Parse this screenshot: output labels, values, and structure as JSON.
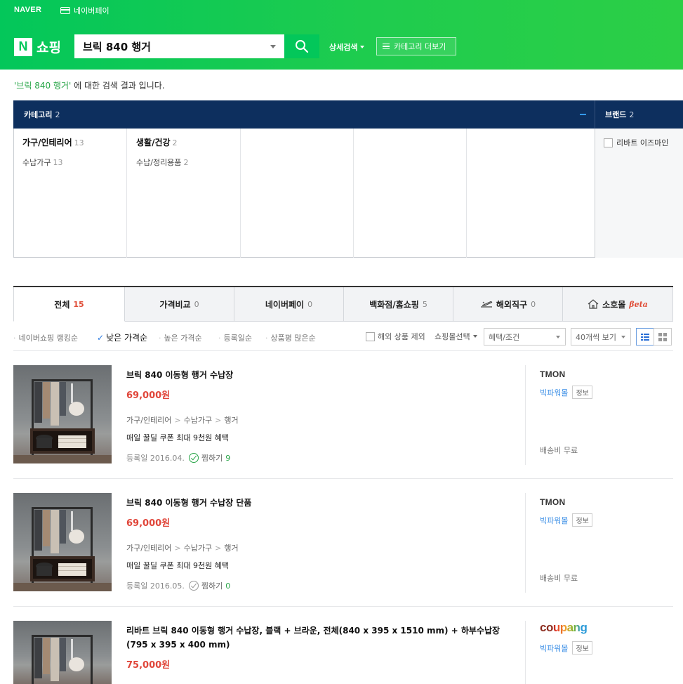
{
  "topbar": {
    "naver": "NAVER",
    "pay": "네이버페이"
  },
  "logo": {
    "mark": "N",
    "text": "쇼핑"
  },
  "search": {
    "query": "브릭 840 행거"
  },
  "header": {
    "detail_search": "상세검색",
    "category_more": "카테고리 더보기"
  },
  "result": {
    "keyword": "'브릭 840 행거'",
    "suffix": " 에 대한 검색 결과 입니다."
  },
  "category_panel": {
    "title": "카테고리",
    "count": "2",
    "columns": [
      {
        "name": "가구/인테리어",
        "count": "13",
        "sub": "수납가구",
        "sub_count": "13"
      },
      {
        "name": "생활/건강",
        "count": "2",
        "sub": "수납/정리용품",
        "sub_count": "2"
      }
    ],
    "brand_title": "브랜드",
    "brand_count": "2",
    "brand_item": "리바트 이즈마인"
  },
  "tabs": [
    {
      "label": "전체",
      "count": "15"
    },
    {
      "label": "가격비교",
      "count": "0"
    },
    {
      "label": "네이버페이",
      "count": "0"
    },
    {
      "label": "백화점/홈쇼핑",
      "count": "5"
    },
    {
      "label": "해외직구",
      "count": "0"
    },
    {
      "label": "소호몰",
      "beta": "βeta"
    }
  ],
  "sort": {
    "options": [
      "네이버쇼핑 랭킹순",
      "낮은 가격순",
      "높은 가격순",
      "등록일순",
      "상품평 많은순"
    ],
    "exclude_overseas": "해외 상품 제외",
    "mall_select": "쇼핑몰선택",
    "benefit_select": "혜택/조건",
    "page_size": "40개씩 보기"
  },
  "products": [
    {
      "title": "브릭 840 이동형 행거 수납장",
      "price": "69,000원",
      "cat1": "가구/인테리어",
      "cat2": "수납가구",
      "cat3": "행거",
      "benefit": "매일 꿀딜 쿠폰 최대 9천원 혜택",
      "registered": "등록일 2016.04.",
      "wish_label": "찜하기",
      "wish_count": "9",
      "mall_logo": "TMON",
      "mall_name": "빅파워몰",
      "info": "정보",
      "shipping": "배송비 무료"
    },
    {
      "title": "브릭 840 이동형 행거 수납장 단품",
      "price": "69,000원",
      "cat1": "가구/인테리어",
      "cat2": "수납가구",
      "cat3": "행거",
      "benefit": "매일 꿀딜 쿠폰 최대 9천원 혜택",
      "registered": "등록일 2016.05.",
      "wish_label": "찜하기",
      "wish_count": "0",
      "mall_logo": "TMON",
      "mall_name": "빅파워몰",
      "info": "정보",
      "shipping": "배송비 무료"
    },
    {
      "title": "리바트 브릭 840 이동형 행거 수납장, 블랙 + 브라운, 전체(840 x 395 x 1510 mm) + 하부수납장(795 x 395 x 400 mm)",
      "price": "75,000원",
      "mall_logo": "coupang",
      "mall_name": "빅파워몰",
      "info": "정보"
    }
  ],
  "colors": {
    "brand_green": "#03c75a",
    "navy": "#0d2f5e",
    "price_red": "#e0463a",
    "mall_blue": "#3a8ee6"
  }
}
